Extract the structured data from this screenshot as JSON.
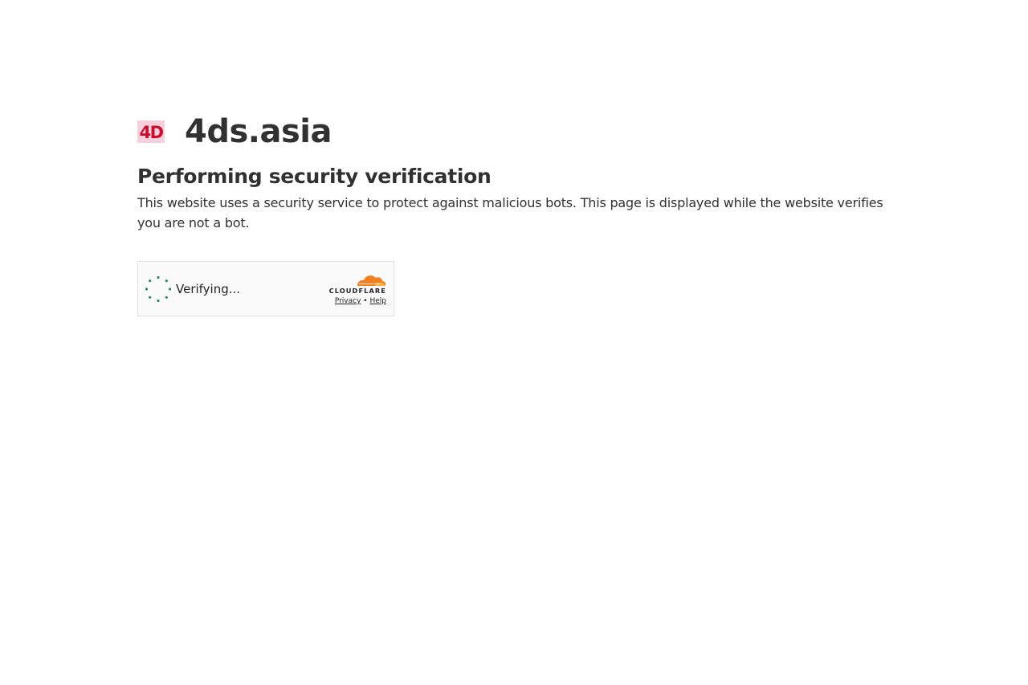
{
  "header": {
    "site_name": "4ds.asia",
    "favicon_text": "4D"
  },
  "main": {
    "heading": "Performing security verification",
    "description": "This website uses a security service to protect against malicious bots. This page is displayed while the website verifies you are not a bot."
  },
  "challenge_widget": {
    "status_text": "Verifying...",
    "brand_name": "CLOUDFLARE",
    "privacy_link": "Privacy",
    "separator": "•",
    "help_link": "Help",
    "spinner_color": "#2f8a6a",
    "brand_color": "#f38020"
  },
  "colors": {
    "text": "#313131",
    "favicon_pink": "#f5c6d6",
    "favicon_red": "#c8102e"
  }
}
